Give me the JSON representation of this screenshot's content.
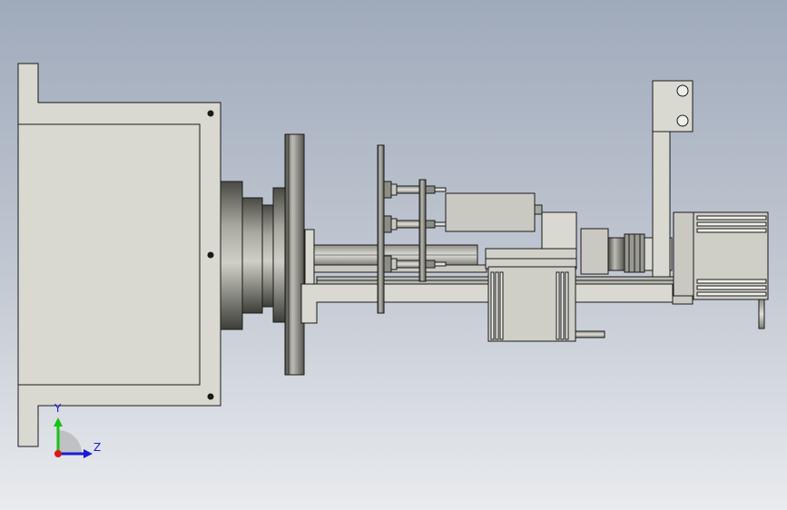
{
  "viewport": {
    "background_top": "#9faabb",
    "background_bottom": "#e9ebee",
    "model_line_color": "#1a1a1a",
    "model_fill_light": "#d9d9d2",
    "model_fill_mid": "#b9b9b2",
    "model_fill_dark": "#5e5e58"
  },
  "triad": {
    "y_label": "Y",
    "z_label": "Z",
    "y_color": "#18c218",
    "z_color": "#1a1ad8",
    "x_color": "#d81a1a"
  }
}
